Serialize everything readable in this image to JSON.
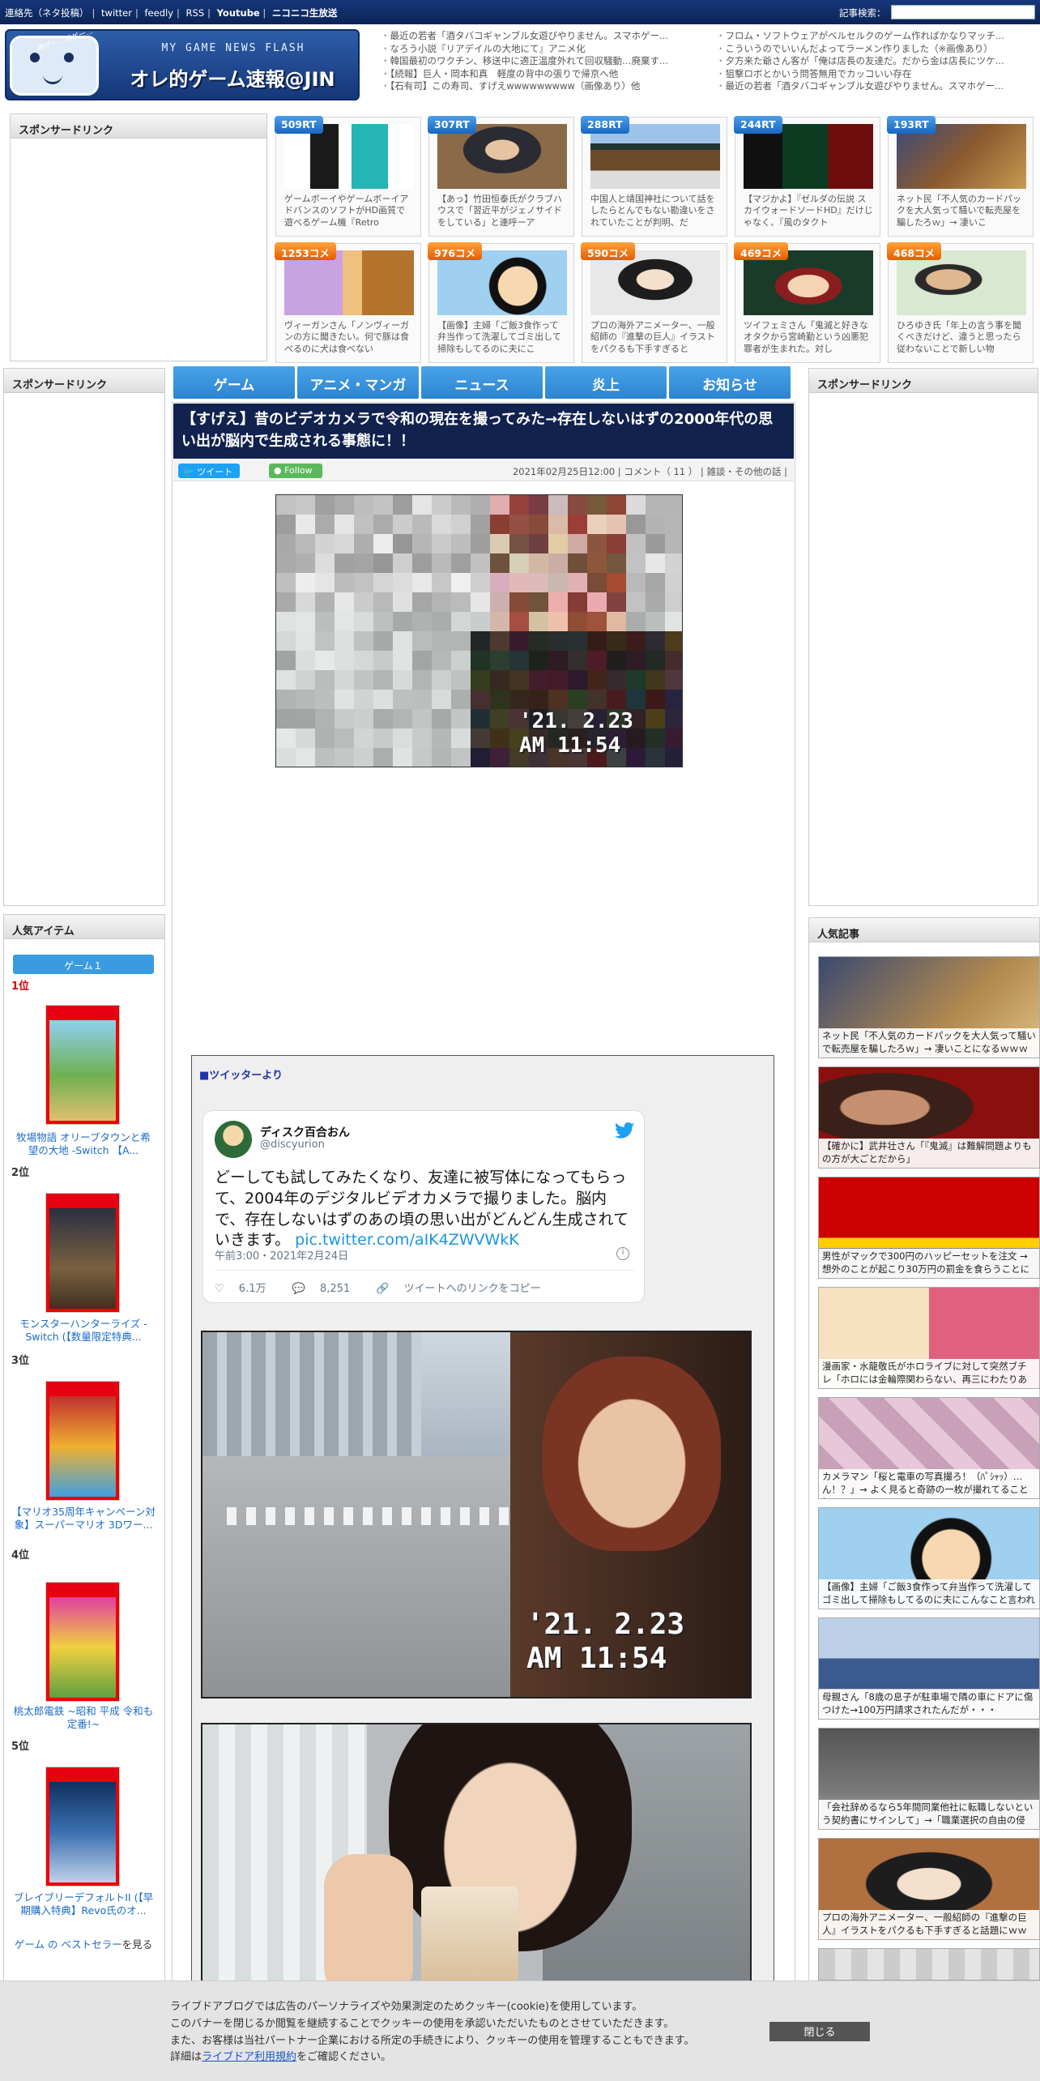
{
  "topbar": {
    "links": [
      "連絡先（ネタ投稿）",
      "twitter",
      "feedly",
      "RSS",
      "Youtube",
      "ニコニコ生放送"
    ],
    "search_label": "記事検索："
  },
  "logo": {
    "subtitle": "MY GAME NEWS FLASH",
    "title": "オレ的ゲーム速報@JIN",
    "speech": "神ゲー…神ゲー…"
  },
  "headlines": {
    "left": [
      "最近の若者「酒タバコギャンブル女遊びやりません。スマホゲー...",
      "なろう小説『リアデイルの大地にて』アニメ化",
      "韓国最初のワクチン、移送中に適正温度外れて回収騒動…廃棄す...",
      "【続報】巨人・岡本和真　軽度の背中の張りで帰京へ他",
      "【石有司】この寿司、すげえwwwwwwwww（画像あり）他"
    ],
    "right": [
      "フロム・ソフトウェアがベルセルクのゲーム作ればかなりマッチ...",
      "こういうのでいいんだよってラーメン作りました（※画像あり）",
      "夕方来た爺さん客が「俺は店長の友達だ。だから金は店長にツケ...",
      "狙撃ロボとかいう問答無用でカッコいい存在",
      "最近の若者「酒タバコギャンブル女遊びやりません。スマホゲー..."
    ]
  },
  "sponsor_label": "スポンサードリンク",
  "cards": [
    {
      "badge": "509RT",
      "kind": "rt",
      "text": "ゲームボーイやゲームボーイアドバンスのソフトがHD画質で遊べるゲーム機『Retro"
    },
    {
      "badge": "307RT",
      "kind": "rt",
      "text": "【あっ】竹田恒泰氏がクラブハウスで「習近平がジェノサイドをしている」と連呼ーア"
    },
    {
      "badge": "288RT",
      "kind": "rt",
      "text": "中国人と靖国神社について話をしたらとんでもない勘違いをされていたことが判明、だ"
    },
    {
      "badge": "244RT",
      "kind": "rt",
      "text": "【マジかよ】『ゼルダの伝説 スカイウォードソードHD』だけじゃなく、『風のタクト"
    },
    {
      "badge": "193RT",
      "kind": "rt",
      "text": "ネット民「不人気のカードパックを大人気って騒いで転売屋を騙したろｗ」→ 凄いこ"
    },
    {
      "badge": "1253コメ",
      "kind": "cm",
      "text": "ヴィーガンさん「ノンヴィーガンの方に聞きたい。何で豚は食べるのに犬は食べない"
    },
    {
      "badge": "976コメ",
      "kind": "cm",
      "text": "【画像】主婦「ご飯3食作って弁当作って洗濯してゴミ出して掃除もしてるのに夫にこ"
    },
    {
      "badge": "590コメ",
      "kind": "cm",
      "text": "プロの海外アニメーター、一般紹師の『進撃の巨人』イラストをパクるも下手すぎると"
    },
    {
      "badge": "469コメ",
      "kind": "cm",
      "text": "ツイフェミさん「鬼滅と好きなオタクから宮崎勤という凶悪犯罪者が生まれた。対し"
    },
    {
      "badge": "468コメ",
      "kind": "cm",
      "text": "ひろゆき氏「年上の言う事を聞くべきだけど、違うと思ったら従わないことで新しい物"
    }
  ],
  "nav": [
    "ゲーム",
    "アニメ・マンガ",
    "ニュース",
    "炎上",
    "お知らせ"
  ],
  "article": {
    "title": "【すげえ】昔のビデオカメラで令和の現在を撮ってみた→存在しないはずの2000年代の思い出が脳内で生成される事態に！！",
    "tweet_btn": "ツイート",
    "follow_btn": "Follow",
    "date": "2021年02月25日12:00",
    "comments": "コメント（ 11 ）",
    "category": "雑談・その他の話",
    "stamp_date": "'21. 2.23",
    "stamp_time": "AM 11:54"
  },
  "twitter_section": {
    "heading": "■ツイッターより",
    "name": "ディスク百合おん",
    "handle": "@discyurion",
    "body": "どーしても試してみたくなり、友達に被写体になってもらって、2004年のデジタルビデオカメラで撮りました。脳内で、存在しないはずのあの頃の思い出がどんどん生成されていきます。",
    "link": "pic.twitter.com/aIK4ZWVWkK",
    "time": "午前3:00・2021年2月24日",
    "likes": "6.1万",
    "replies": "8,251",
    "copy": "ツイートへのリンクをコピー"
  },
  "left_sidebar": {
    "popular_items_heading": "人気アイテム",
    "tab": "ゲーム１",
    "ranks": [
      {
        "rank": "1位",
        "title": "牧場物語 オリーブタウンと希望の大地 -Switch 【A..."
      },
      {
        "rank": "2位",
        "title": "モンスターハンターライズ -Switch (【数量限定特典..."
      },
      {
        "rank": "3位",
        "title": "【マリオ35周年キャンペーン対象】スーパーマリオ 3Dワー..."
      },
      {
        "rank": "4位",
        "title": "桃太郎電鉄 ~昭和 平成 令和も定番!~"
      },
      {
        "rank": "5位",
        "title": "ブレイブリーデフォルトII (【早期購入特典】Revo氏のオ..."
      }
    ],
    "bestseller": "ゲーム の ベストセラー",
    "bestseller_suffix": "を見る"
  },
  "right_sidebar": {
    "popular_heading": "人気記事",
    "articles": [
      "ネット民「不人気のカードパックを大人気って騒いで転売屋を騙したろｗ」→ 凄いことになるｗｗｗ",
      "【確かに】武井壮さん「『鬼滅』は難解問題よりもの方が大ごとだから」",
      "男性がマックで300円のハッピーセットを注文 → 想外のことが起こり30万円の罰金を食らうことに",
      "漫画家・水龍敬氏がホロライブに対して突然ブチレ「ホロには金輪際関わらない、再三にわたりあ",
      "カメラマン「桜と電車の写真撮ろ！（ﾊﾟｼｬｯ）…ん！？」→ よく見ると奇跡の一枚が撮れてることに",
      "【画像】主婦「ご飯3食作って弁当作って洗濯してゴミ出して掃除もしてるのに夫にこんなこと言われ",
      "母親さん「8歳の息子が駐車場で隣の車にドアに傷つけた→100万円請求されたんだが・・・",
      "「会社辞めるなら5年間同業他社に転職しないという契約書にサインして」→「職業選択の自由の侵",
      "プロの海外アニメーター、一般紹師の『進撃の巨人』イラストをパクるも下手すぎると話題にｗｗ",
      ""
    ]
  },
  "cookie": {
    "line1": "ライブドアブログでは広告のパーソナライズや効果測定のためクッキー(cookie)を使用しています。",
    "line2": "このバナーを閉じるか閲覧を継続することでクッキーの使用を承認いただいたものとさせていただきます。",
    "line3": "また、お客様は当社パートナー企業における所定の手続きにより、クッキーの使用を管理することもできます。",
    "line4_prefix": "詳細は",
    "line4_link": "ライブドア利用規約",
    "line4_suffix": "をご確認ください。",
    "close": "閉じる"
  }
}
